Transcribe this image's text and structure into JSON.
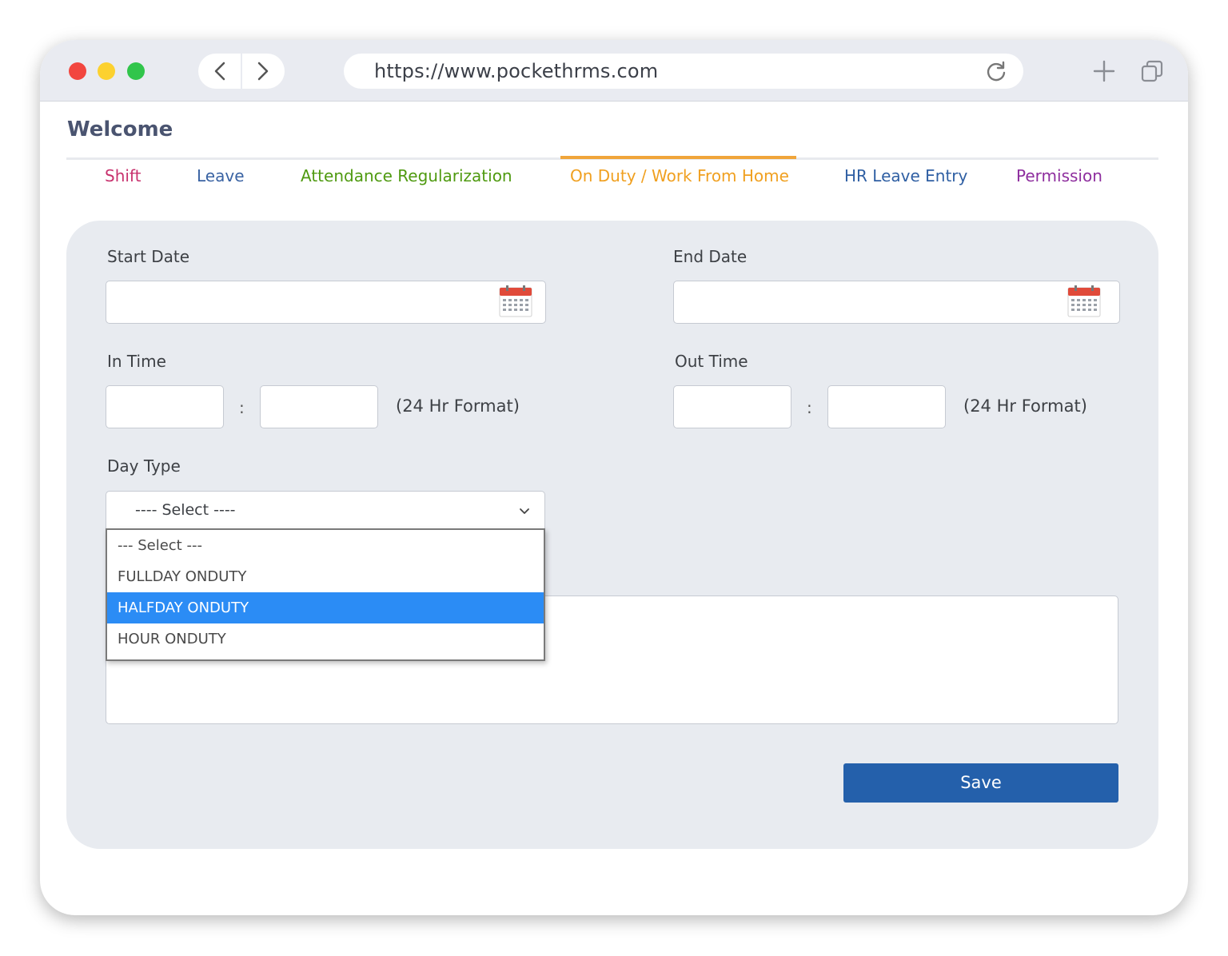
{
  "browser": {
    "url": "https://www.pockethrms.com"
  },
  "page": {
    "welcome": "Welcome"
  },
  "tabs": [
    {
      "label": "Shift",
      "color": "#c8326e"
    },
    {
      "label": "Leave",
      "color": "#3a63a3"
    },
    {
      "label": "Attendance Regularization",
      "color": "#4f9a10"
    },
    {
      "label": "On Duty / Work From Home",
      "color": "#f0a020",
      "active": true
    },
    {
      "label": "HR Leave Entry",
      "color": "#2f5fa3"
    },
    {
      "label": "Permission",
      "color": "#8e2e9e"
    }
  ],
  "form": {
    "start_date_label": "Start Date",
    "end_date_label": "End Date",
    "in_time_label": "In Time",
    "out_time_label": "Out Time",
    "time_separator": ":",
    "format_hint": "(24 Hr Format)",
    "day_type_label": "Day Type",
    "day_type_selected": "---- Select ----",
    "day_type_options": [
      "--- Select ---",
      "FULLDAY ONDUTY",
      "HALFDAY ONDUTY",
      "HOUR ONDUTY"
    ],
    "highlighted_option": "HALFDAY ONDUTY",
    "save_label": "Save"
  },
  "colors": {
    "accent": "#f0a53a",
    "save_button": "#2460ab",
    "option_highlight": "#2b8cf5",
    "calendar_top": "#e04a3a"
  }
}
